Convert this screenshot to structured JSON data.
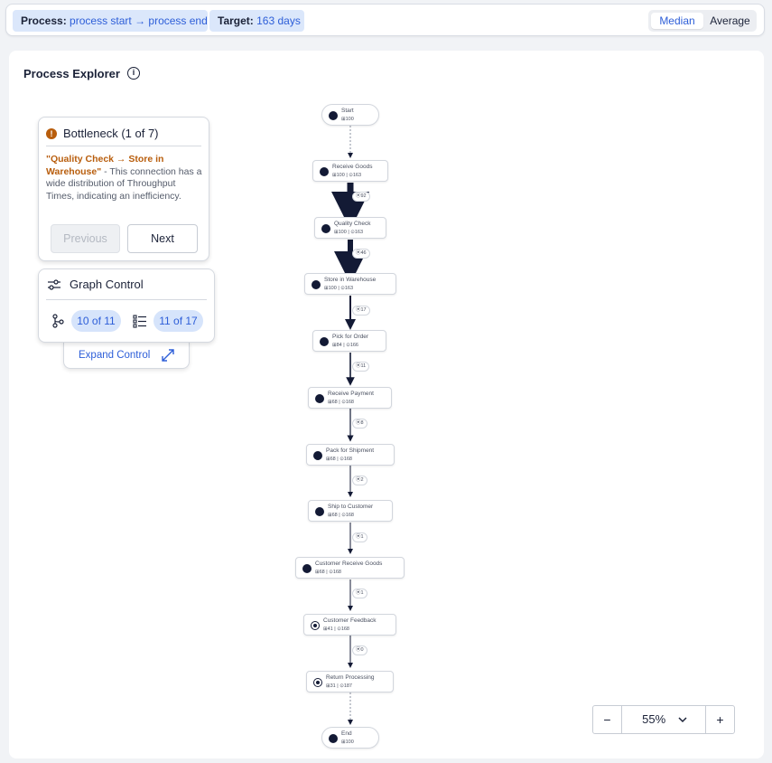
{
  "header": {
    "process_label": "Process:",
    "process_value": "process start → process end",
    "target_label": "Target:",
    "target_value": "163 days",
    "toggle_median": "Median",
    "toggle_average": "Average"
  },
  "explorer": {
    "title": "Process Explorer"
  },
  "bottleneck": {
    "title": "Bottleneck (1 of 7)",
    "highlight": "\"Quality Check → Store in Warehouse\"",
    "text": " - This connection has a wide distribution of Throughput Times, indicating an inefficiency.",
    "previous_label": "Previous",
    "next_label": "Next"
  },
  "graph_control": {
    "title": "Graph Control",
    "paths_value": "10 of 11",
    "activities_value": "11 of 17",
    "expand_label": "Expand Control"
  },
  "nodes": [
    {
      "label": "Start",
      "meta": "⊞100"
    },
    {
      "label": "Receive Goods",
      "meta": "⊞100 | ⊙163"
    },
    {
      "label": "Quality Check",
      "meta": "⊞100 | ⊙163"
    },
    {
      "label": "Store in Warehouse",
      "meta": "⊞100 | ⊙163"
    },
    {
      "label": "Pick for Order",
      "meta": "⊞84 | ⊙166"
    },
    {
      "label": "Receive Payment",
      "meta": "⊞68 | ⊙168"
    },
    {
      "label": "Pack for Shipment",
      "meta": "⊞68 | ⊙168"
    },
    {
      "label": "Ship to Customer",
      "meta": "⊞68 | ⊙168"
    },
    {
      "label": "Customer Receive Goods",
      "meta": "⊞68 | ⊙168"
    },
    {
      "label": "Customer Feedback",
      "meta": "⊞41 | ⊙168"
    },
    {
      "label": "Return Processing",
      "meta": "⊞31 | ⊙187"
    },
    {
      "label": "End",
      "meta": "⊞100"
    }
  ],
  "edges": [
    {
      "label": "⦿92"
    },
    {
      "label": "⦿46"
    },
    {
      "label": "⦿17"
    },
    {
      "label": "⦿11"
    },
    {
      "label": "⦿8"
    },
    {
      "label": "⦿2"
    },
    {
      "label": "⦿1"
    },
    {
      "label": "⦿1"
    },
    {
      "label": "⦿0"
    }
  ],
  "zoom": {
    "value": "55%",
    "minus": "−",
    "plus": "+"
  },
  "colors": {
    "accent": "#2d5ed8",
    "warning": "#b85d0c",
    "node_dot": "#131a35"
  }
}
